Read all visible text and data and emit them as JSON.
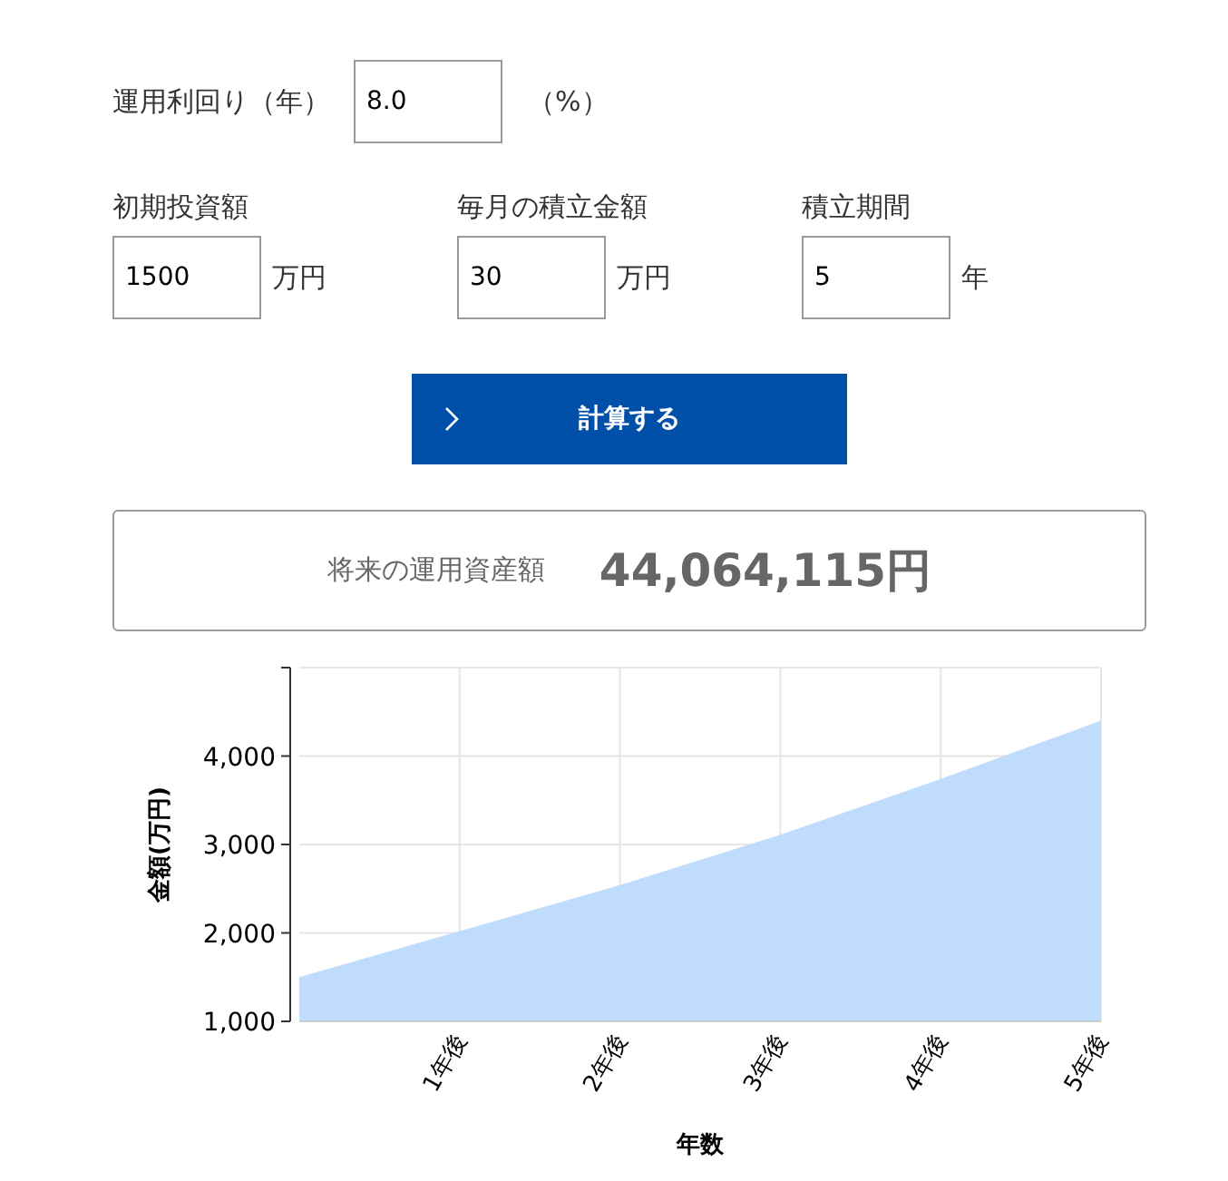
{
  "rate": {
    "label": "運用利回り（年）",
    "value": "8.0",
    "unit": "（%）"
  },
  "fields": [
    {
      "label": "初期投資額",
      "value": "1500",
      "unit": "万円"
    },
    {
      "label": "毎月の積立金額",
      "value": "30",
      "unit": "万円"
    },
    {
      "label": "積立期間",
      "value": "5",
      "unit": "年"
    }
  ],
  "button": {
    "label": "計算する"
  },
  "result": {
    "label": "将来の運用資産額",
    "value": "44,064,115円"
  },
  "chart": {
    "chart_data": {
      "type": "area",
      "xlabel": "年数",
      "ylabel": "金額(万円)",
      "x": [
        0,
        1,
        2,
        3,
        4,
        5
      ],
      "grid": true,
      "series": [
        {
          "color": "#c0dcfd",
          "values": [
            1500,
            2020,
            2540,
            3110,
            3740,
            4400
          ]
        }
      ],
      "xlim": [
        0,
        5
      ],
      "ylim": [
        1000,
        5000
      ],
      "xticks": [
        {
          "value": 1,
          "label": "1年後"
        },
        {
          "value": 2,
          "label": "2年後"
        },
        {
          "value": 3,
          "label": "3年後"
        },
        {
          "value": 4,
          "label": "4年後"
        },
        {
          "value": 5,
          "label": "5年後"
        }
      ],
      "yticks": [
        {
          "value": 1000,
          "label": "1,000"
        },
        {
          "value": 2000,
          "label": "2,000"
        },
        {
          "value": 3000,
          "label": "3,000"
        },
        {
          "value": 4000,
          "label": "4,000"
        }
      ]
    }
  }
}
